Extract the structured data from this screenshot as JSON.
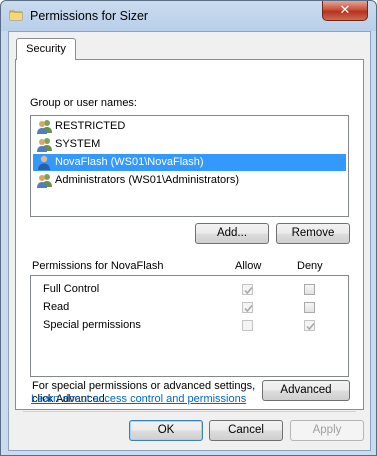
{
  "window": {
    "title": "Permissions for Sizer",
    "close_glyph": "✕"
  },
  "tabs": [
    {
      "label": "Security"
    }
  ],
  "group_section": {
    "label": "Group or user names:",
    "users": [
      {
        "name": "RESTRICTED",
        "icon": "user-group-icon",
        "selected": false
      },
      {
        "name": "SYSTEM",
        "icon": "user-group-icon",
        "selected": false
      },
      {
        "name": "NovaFlash (WS01\\NovaFlash)",
        "icon": "user-icon",
        "selected": true
      },
      {
        "name": "Administrators (WS01\\Administrators)",
        "icon": "user-group-icon",
        "selected": false
      }
    ],
    "add_label": "Add...",
    "remove_label": "Remove"
  },
  "permissions": {
    "header": "Permissions for NovaFlash",
    "allow_label": "Allow",
    "deny_label": "Deny",
    "rows": [
      {
        "name": "Full Control",
        "allow": true,
        "deny": false
      },
      {
        "name": "Read",
        "allow": true,
        "deny": false
      },
      {
        "name": "Special permissions",
        "allow": false,
        "deny": true
      }
    ]
  },
  "advanced": {
    "text_line1": "For special permissions or advanced settings,",
    "text_line2": "click Advanced.",
    "button_label": "Advanced"
  },
  "link_text": "Learn about access control and permissions",
  "footer": {
    "ok_label": "OK",
    "cancel_label": "Cancel",
    "apply_label": "Apply"
  },
  "colors": {
    "selection": "#3399ff",
    "link": "#0066cc"
  }
}
